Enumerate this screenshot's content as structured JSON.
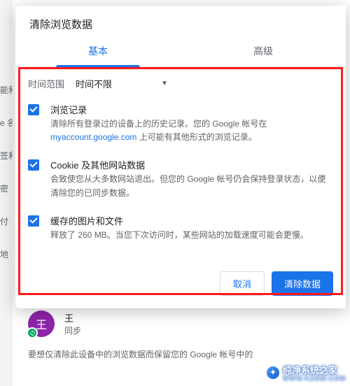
{
  "bg_sidebar": [
    "能和",
    "e 名",
    "签和",
    "密",
    "付",
    "地"
  ],
  "dialog": {
    "title": "清除浏览数据",
    "tabs": {
      "basic": "基本",
      "advanced": "高级"
    },
    "time": {
      "label": "时间范围",
      "value": "时间不限"
    },
    "items": [
      {
        "title": "浏览记录",
        "desc1": "清除所有登录过的设备上的历史记录。您的 Google 帐号在",
        "desc2": "上可能有其他形式的浏览记录。"
      },
      {
        "title": "Cookie 及其他网站数据",
        "desc1": "会致使您从大多数网站退出。但您的 Google 帐号仍会保持登录状态，以便清除您的已同步数据。"
      },
      {
        "title": "缓存的图片和文件",
        "desc1": "释放了 260 MB。当您下次访问时，某些网站的加载速度可能会更慢。"
      }
    ],
    "actions": {
      "cancel": "取消",
      "clear": "清除数据"
    }
  },
  "profile": {
    "avatar_letter": "王",
    "name": "王",
    "sync": "同步"
  },
  "bottom_note": "要想仅清除此设备中的浏览数据而保留您的 Google 帐号中的",
  "watermark": {
    "main": "纯净系统之家",
    "sub": "WWW.KZMW.COM"
  }
}
